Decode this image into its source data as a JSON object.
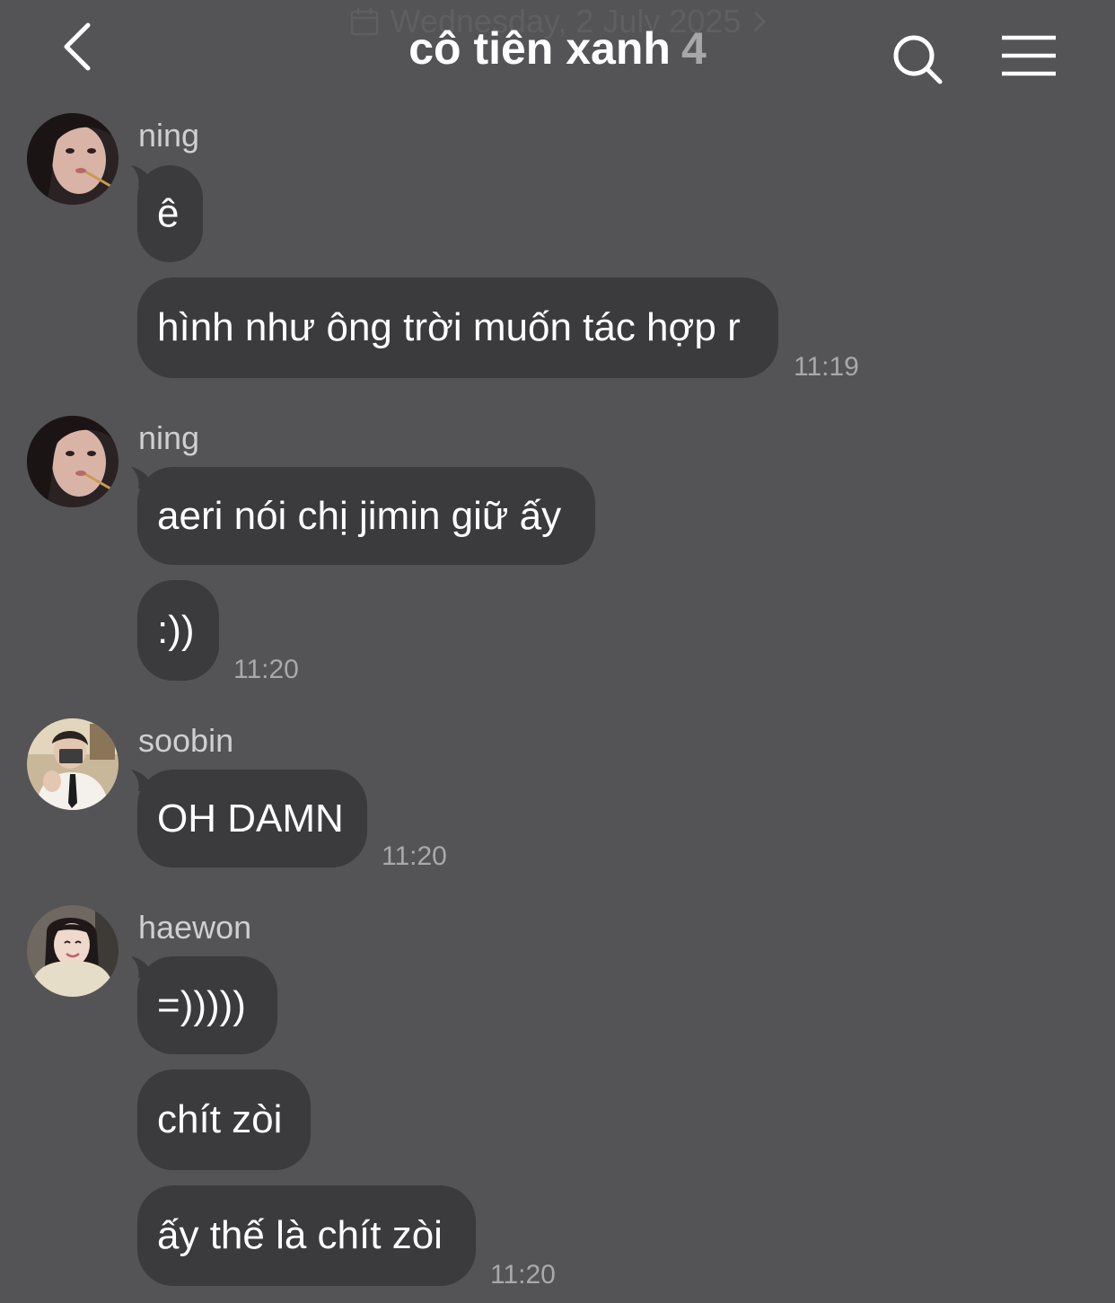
{
  "colors": {
    "background": "#545355",
    "bubble": "#3b3a3d",
    "text": "#ffffff",
    "muted": "#a9a8aa"
  },
  "header": {
    "date_label": "Wednesday, 2 July 2025",
    "title": "cô tiên xanh",
    "member_count": "4",
    "back_icon": "chevron-left-icon",
    "search_icon": "search-icon",
    "menu_icon": "hamburger-menu-icon"
  },
  "messages": [
    {
      "sender": "ning",
      "bubbles": [
        "ê",
        "hình như ông trời muốn tác hợp r"
      ],
      "time": "11:19"
    },
    {
      "sender": "ning",
      "bubbles": [
        "aeri nói chị jimin giữ ấy",
        ":))"
      ],
      "time": "11:20"
    },
    {
      "sender": "soobin",
      "bubbles": [
        "OH DAMN"
      ],
      "time": "11:20"
    },
    {
      "sender": "haewon",
      "bubbles": [
        "=)))))",
        "chít zòi",
        "ấy thế là chít zòi"
      ],
      "time": "11:20"
    }
  ]
}
